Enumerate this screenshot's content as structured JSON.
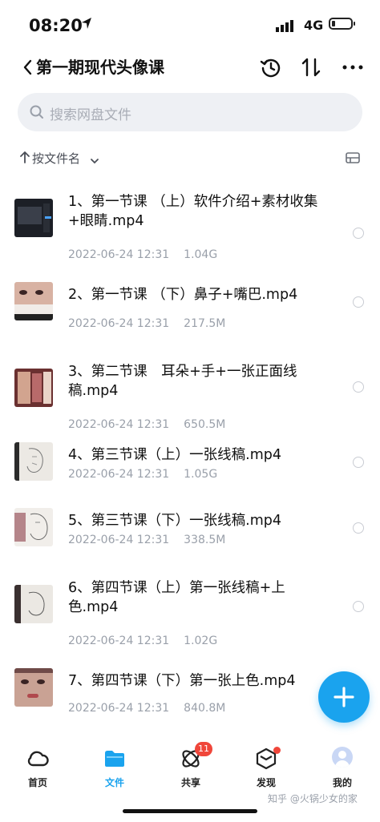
{
  "status": {
    "time": "08:20",
    "network": "4G"
  },
  "header": {
    "title": "第一期现代头像课"
  },
  "search": {
    "placeholder": "搜索网盘文件"
  },
  "sort": {
    "label": "按文件名"
  },
  "files": [
    {
      "name": "1、第一节课 （上）软件介绍+素材收集+眼睛.mp4",
      "date": "2022-06-24 12:31",
      "size": "1.04G",
      "thumb_colors": [
        "#1c1f26",
        "#3a3f4a"
      ]
    },
    {
      "name": "2、第一节课 （下）鼻子+嘴巴.mp4",
      "date": "2022-06-24 12:31",
      "size": "217.5M",
      "thumb_colors": [
        "#c89a88",
        "#222"
      ]
    },
    {
      "name": "3、第二节课　耳朵+手+一张正面线稿.mp4",
      "date": "2022-06-24 12:31",
      "size": "650.5M",
      "thumb_colors": [
        "#8a3a3a",
        "#d2a48f"
      ]
    },
    {
      "name": "4、第三节课（上）一张线稿.mp4",
      "date": "2022-06-24 12:31",
      "size": "1.05G",
      "thumb_colors": [
        "#e9e6e1",
        "#2b2b2b"
      ]
    },
    {
      "name": "5、第三节课（下）一张线稿.mp4",
      "date": "2022-06-24 12:31",
      "size": "338.5M",
      "thumb_colors": [
        "#f1eeea",
        "#b5858a"
      ]
    },
    {
      "name": "6、第四节课（上）第一张线稿+上色.mp4",
      "date": "2022-06-24 12:31",
      "size": "1.02G",
      "thumb_colors": [
        "#ebe8e3",
        "#3a3030"
      ]
    },
    {
      "name": "7、第四节课（下）第一张上色.mp4",
      "date": "2022-06-24 12:31",
      "size": "840.8M",
      "thumb_colors": [
        "#c9a294",
        "#6f4a48"
      ]
    }
  ],
  "tabs": [
    {
      "label": "首页",
      "icon": "cloud-icon"
    },
    {
      "label": "文件",
      "icon": "folder-icon",
      "active": true
    },
    {
      "label": "共享",
      "icon": "share-orbit-icon",
      "badge": "11"
    },
    {
      "label": "发现",
      "icon": "cube-icon",
      "dot": true
    },
    {
      "label": "我的",
      "icon": "avatar-icon"
    }
  ],
  "watermark": "知乎 @火锅少女的家",
  "colors": {
    "accent": "#1aa3ee",
    "badge": "#f0463a",
    "search_bg": "#eef0f4"
  }
}
